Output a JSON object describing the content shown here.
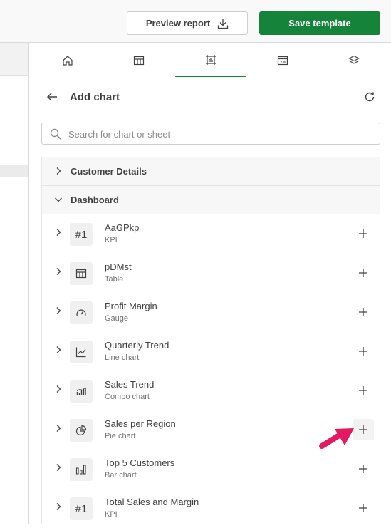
{
  "toolbar": {
    "preview_label": "Preview report",
    "save_label": "Save template"
  },
  "tabs": [
    {
      "icon": "home-icon",
      "active": false
    },
    {
      "icon": "table-icon",
      "active": false
    },
    {
      "icon": "chart-frame-icon",
      "active": true
    },
    {
      "icon": "variable-icon",
      "active": false
    },
    {
      "icon": "layers-icon",
      "active": false
    }
  ],
  "panel": {
    "title": "Add chart",
    "search_placeholder": "Search for chart or sheet"
  },
  "sections": [
    {
      "label": "Customer Details",
      "expanded": false
    },
    {
      "label": "Dashboard",
      "expanded": true
    }
  ],
  "items": [
    {
      "name": "AaGPkp",
      "type": "KPI",
      "icon": "kpi-icon"
    },
    {
      "name": "pDMst",
      "type": "Table",
      "icon": "table-icon"
    },
    {
      "name": "Profit Margin",
      "type": "Gauge",
      "icon": "gauge-icon"
    },
    {
      "name": "Quarterly Trend",
      "type": "Line chart",
      "icon": "line-chart-icon"
    },
    {
      "name": "Sales Trend",
      "type": "Combo chart",
      "icon": "combo-chart-icon"
    },
    {
      "name": "Sales per Region",
      "type": "Pie chart",
      "icon": "pie-chart-icon"
    },
    {
      "name": "Top 5 Customers",
      "type": "Bar chart",
      "icon": "bar-chart-icon"
    },
    {
      "name": "Total Sales and Margin",
      "type": "KPI",
      "icon": "kpi-icon"
    }
  ],
  "kpi_glyph": "#1",
  "colors": {
    "accent": "#15833a",
    "pointer": "#e5195f"
  }
}
